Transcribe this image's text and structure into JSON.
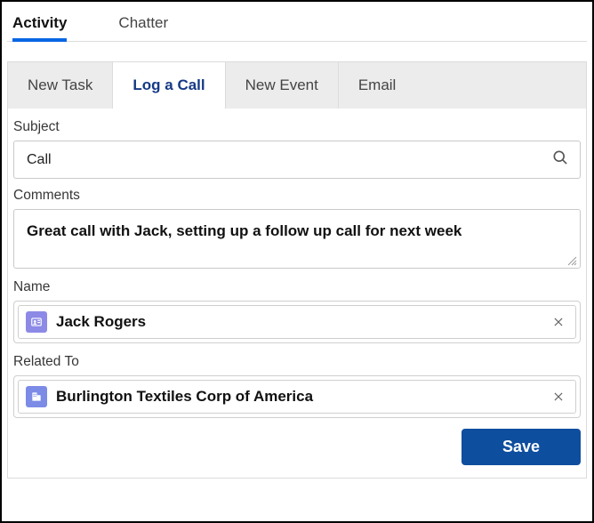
{
  "topTabs": {
    "activity": "Activity",
    "chatter": "Chatter"
  },
  "actionTabs": {
    "newTask": "New Task",
    "logACall": "Log a Call",
    "newEvent": "New Event",
    "email": "Email"
  },
  "form": {
    "subjectLabel": "Subject",
    "subjectValue": "Call",
    "commentsLabel": "Comments",
    "commentsValue": "Great call with Jack, setting up a follow up call for next week",
    "nameLabel": "Name",
    "nameValue": "Jack Rogers",
    "relatedToLabel": "Related To",
    "relatedToValue": "Burlington Textiles Corp of America",
    "saveLabel": "Save"
  },
  "colors": {
    "primaryTabUnderline": "#0866e4",
    "actionTabActiveText": "#153a86",
    "saveButtonBg": "#0e4e9e",
    "contactIconBg": "#8c8ae6",
    "accountIconBg": "#7b8be6"
  }
}
